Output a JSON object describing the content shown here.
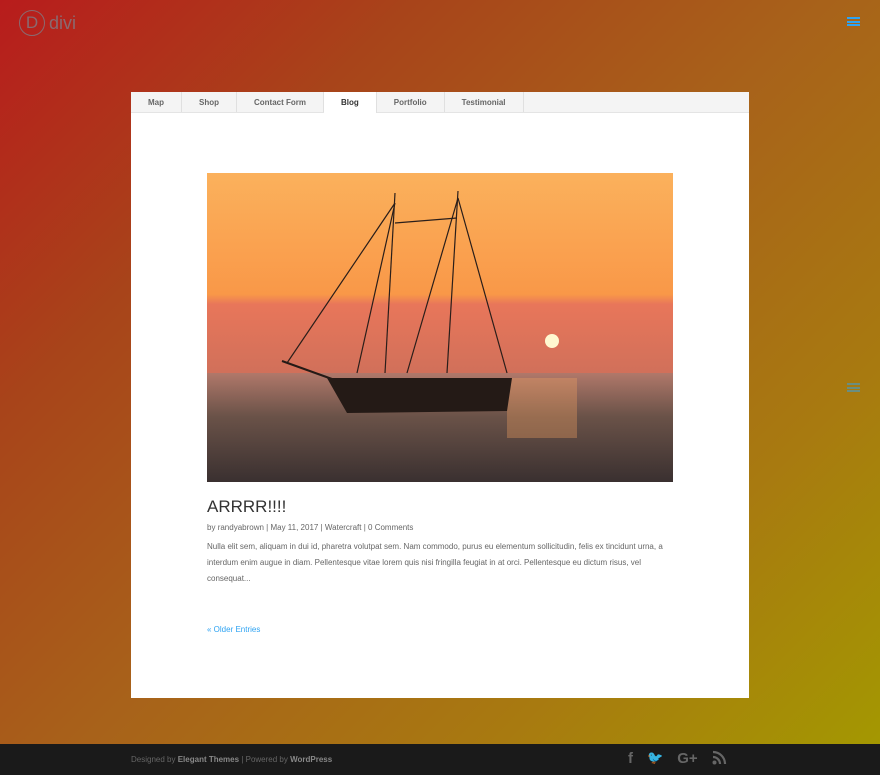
{
  "header": {
    "logo_letter": "D",
    "logo_text": "divi"
  },
  "tabs": [
    {
      "label": "Map"
    },
    {
      "label": "Shop"
    },
    {
      "label": "Contact Form"
    },
    {
      "label": "Blog",
      "active": true
    },
    {
      "label": "Portfolio"
    },
    {
      "label": "Testimonial"
    }
  ],
  "post": {
    "title": "ARRRR!!!!",
    "author": "randyabrown",
    "by": "by",
    "date": "May 11, 2017",
    "category": "Watercraft",
    "comments": "0 Comments",
    "excerpt": "Nulla elit sem, aliquam in dui id, pharetra volutpat sem. Nam commodo, purus eu elementum sollicitudin, felis ex tincidunt urna, a interdum enim augue in diam. Pellentesque vitae lorem quis nisi fringilla feugiat in at orci. Pellentesque eu dictum risus, vel consequat..."
  },
  "pagination": {
    "older": "« Older Entries"
  },
  "footer": {
    "designed_by": "Designed by",
    "elegant": "Elegant Themes",
    "powered_by": "| Powered by",
    "wordpress": "WordPress",
    "social": [
      {
        "icon": "facebook-icon",
        "glyph": "f"
      },
      {
        "icon": "twitter-icon",
        "glyph": "🐦"
      },
      {
        "icon": "google-plus-icon",
        "glyph": "G+"
      },
      {
        "icon": "rss-icon",
        "glyph": "⦿"
      }
    ]
  },
  "colors": {
    "accent": "#2ea3f2"
  }
}
